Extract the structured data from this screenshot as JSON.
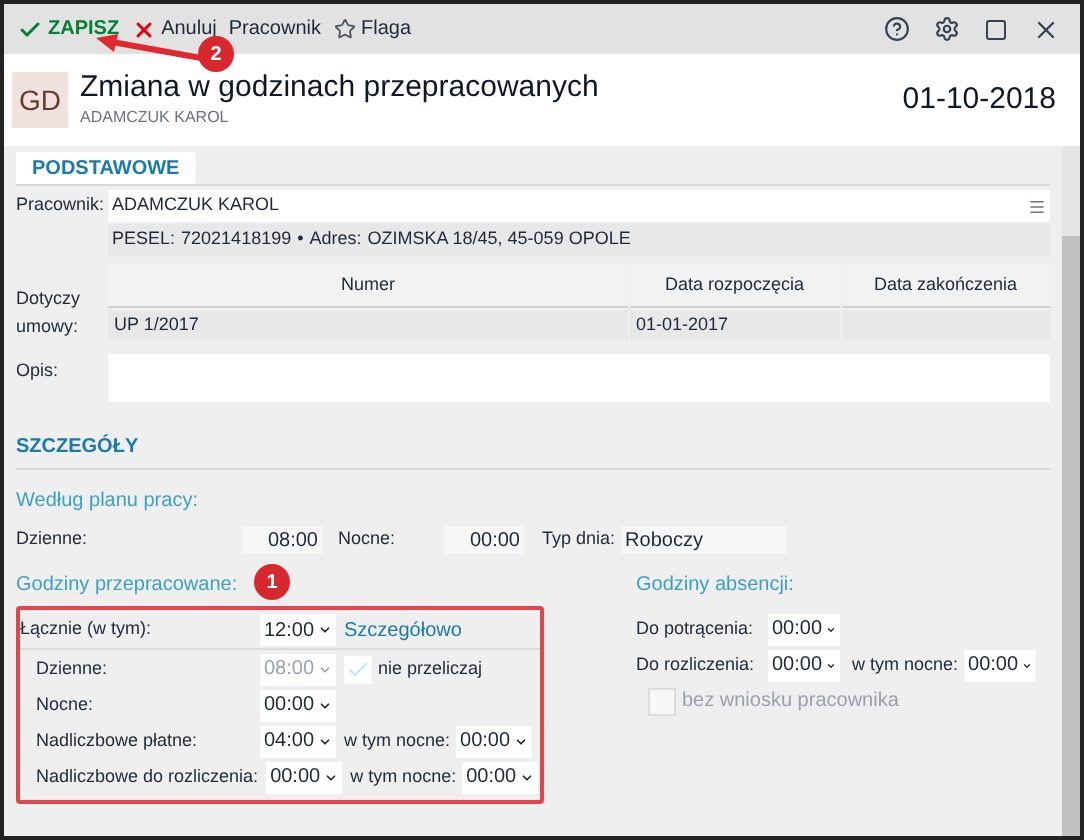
{
  "toolbar": {
    "buttons": [
      {
        "label": "ZAPISZ",
        "kind": "save"
      },
      {
        "label": "Anuluj",
        "kind": "cancel"
      },
      {
        "label": "Pracownik",
        "kind": "plain"
      },
      {
        "label": "Flaga",
        "kind": "flag"
      }
    ]
  },
  "header": {
    "initials": "GD",
    "title": "Zmiana w godzinach przepracowanych",
    "subtitle": "ADAMCZUK KAROL",
    "date": "01-10-2018"
  },
  "tabs": [
    {
      "label": "PODSTAWOWE",
      "selected": true
    }
  ],
  "employee": {
    "label": "Pracownik:",
    "value": "ADAMCZUK KAROL",
    "pesel_label": "PESEL:",
    "pesel": "72021418199",
    "separator": "•",
    "address_label": "Adres:",
    "address": "OZIMSKA 18/45, 45-059 OPOLE"
  },
  "contract": {
    "label": "Dotyczy umowy:",
    "columns": [
      "Numer",
      "Data rozpoczęcia",
      "Data zakończenia"
    ],
    "rows": [
      [
        "UP 1/2017",
        "01-01-2017",
        ""
      ]
    ]
  },
  "description": {
    "label": "Opis:"
  },
  "details": {
    "title": "SZCZEGÓŁY",
    "plan": {
      "heading": "Według planu pracy:",
      "day_label": "Dzienne:",
      "day_value": "08:00",
      "night_label": "Nocne:",
      "night_value": "00:00",
      "type_label": "Typ dnia:",
      "type_value": "Roboczy"
    },
    "worked": {
      "heading": "Godziny przepracowane:",
      "total_label": "Łącznie (w tym):",
      "total_value": "12:00",
      "link": "Szczegółowo",
      "rows": [
        {
          "label": "Dzienne:",
          "value": "08:00",
          "disabled": true,
          "kind": "checkbox",
          "extra_label": "nie przeliczaj",
          "checked": true
        },
        {
          "label": "Nocne:",
          "value": "00:00",
          "disabled": false,
          "kind": "plain"
        },
        {
          "label": "Nadliczbowe płatne:",
          "value": "04:00",
          "disabled": false,
          "kind": "night",
          "extra_label": "w tym nocne:",
          "extra_value": "00:00"
        },
        {
          "label": "Nadliczbowe do rozliczenia:",
          "value": "00:00",
          "disabled": false,
          "kind": "night",
          "extra_label": "w tym nocne:",
          "extra_value": "00:00"
        }
      ]
    },
    "absence": {
      "heading": "Godziny absencji:",
      "rows": [
        {
          "label": "Do potrącenia:",
          "value": "00:00",
          "kind": "plain"
        },
        {
          "label": "Do rozliczenia:",
          "value": "00:00",
          "kind": "night",
          "extra_label": "w tym nocne:",
          "extra_value": "00:00"
        }
      ],
      "checkbox": {
        "label": "bez wniosku pracownika",
        "checked": false,
        "disabled": true
      }
    }
  },
  "annotations": [
    {
      "number": "2"
    },
    {
      "number": "1"
    }
  ]
}
